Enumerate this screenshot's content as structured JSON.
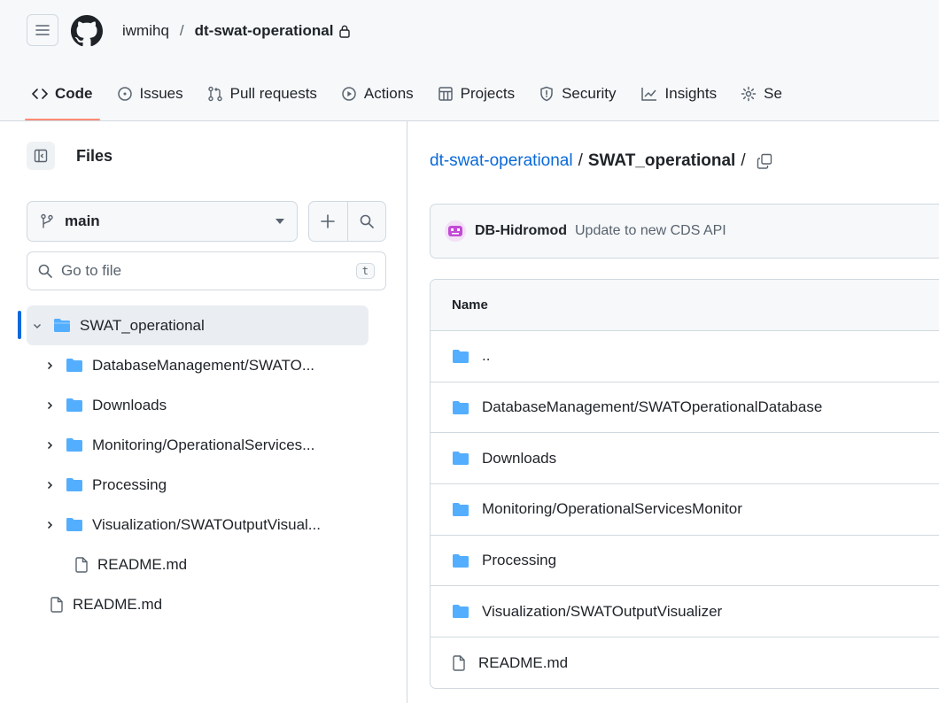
{
  "header": {
    "owner": "iwmihq",
    "separator": "/",
    "repo": "dt-swat-operational",
    "tabs": [
      {
        "label": "Code",
        "icon": "code-icon",
        "active": true
      },
      {
        "label": "Issues",
        "icon": "issue-icon"
      },
      {
        "label": "Pull requests",
        "icon": "pull-request-icon"
      },
      {
        "label": "Actions",
        "icon": "play-icon"
      },
      {
        "label": "Projects",
        "icon": "table-icon"
      },
      {
        "label": "Security",
        "icon": "shield-icon"
      },
      {
        "label": "Insights",
        "icon": "graph-icon"
      },
      {
        "label": "Se",
        "icon": "gear-icon"
      }
    ]
  },
  "sidebar": {
    "title": "Files",
    "branch": "main",
    "goto_placeholder": "Go to file",
    "goto_shortcut": "t",
    "tree": [
      {
        "label": "SWAT_operational",
        "type": "folder",
        "expanded": true,
        "selected": true,
        "level": 0
      },
      {
        "label": "DatabaseManagement/SWATO...",
        "type": "folder",
        "level": 1
      },
      {
        "label": "Downloads",
        "type": "folder",
        "level": 1
      },
      {
        "label": "Monitoring/OperationalServices...",
        "type": "folder",
        "level": 1
      },
      {
        "label": "Processing",
        "type": "folder",
        "level": 1
      },
      {
        "label": "Visualization/SWATOutputVisual...",
        "type": "folder",
        "level": 1
      },
      {
        "label": "README.md",
        "type": "file",
        "level": 1
      },
      {
        "label": "README.md",
        "type": "file",
        "level": 0
      }
    ]
  },
  "content": {
    "path_repo": "dt-swat-operational",
    "path_sep1": "/",
    "path_current": "SWAT_operational",
    "path_sep2": "/",
    "commit_author": "DB-Hidromod",
    "commit_message": "Update to new CDS API",
    "table_header": "Name",
    "rows": [
      {
        "name": "..",
        "type": "folder"
      },
      {
        "name": "DatabaseManagement/SWATOperationalDatabase",
        "type": "folder"
      },
      {
        "name": "Downloads",
        "type": "folder"
      },
      {
        "name": "Monitoring/OperationalServicesMonitor",
        "type": "folder"
      },
      {
        "name": "Processing",
        "type": "folder"
      },
      {
        "name": "Visualization/SWATOutputVisualizer",
        "type": "folder"
      },
      {
        "name": "README.md",
        "type": "file"
      }
    ]
  },
  "colors": {
    "accent": "#0969da",
    "folder": "#54aeff",
    "tab_underline": "#fd8c73",
    "avatar": "#c24bd6"
  }
}
